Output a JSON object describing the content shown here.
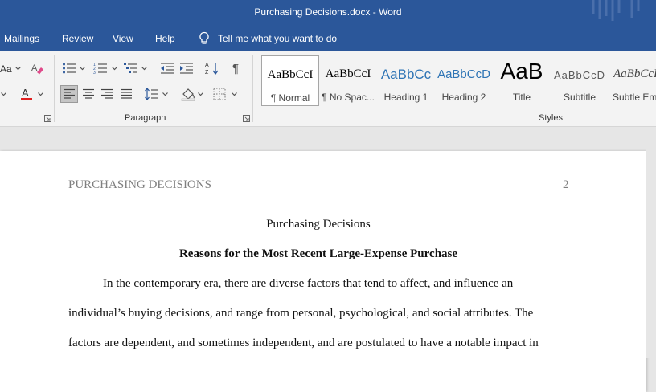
{
  "window": {
    "title": "Purchasing Decisions.docx  -  Word"
  },
  "menu": {
    "tabs": [
      "Mailings",
      "Review",
      "View",
      "Help"
    ],
    "tell_me": "Tell me what you want to do"
  },
  "ribbon": {
    "font_size_partial": "Aa",
    "paragraph_label": "Paragraph",
    "styles_label": "Styles",
    "styles": [
      {
        "sample": "AaBbCcI",
        "name": "¶ Normal"
      },
      {
        "sample": "AaBbCcI",
        "name": "¶ No Spac..."
      },
      {
        "sample": "AaBbCc",
        "name": "Heading 1"
      },
      {
        "sample": "AaBbCcD",
        "name": "Heading 2"
      },
      {
        "sample": "AaB",
        "name": "Title"
      },
      {
        "sample": "AaBbCcD",
        "name": "Subtitle"
      },
      {
        "sample": "AaBbCcD",
        "name": "Subtle Em..."
      }
    ]
  },
  "colors": {
    "brand": "#2b579a",
    "font_color": "#e02020",
    "heading_blue": "#2e74b5"
  },
  "document": {
    "running_head": "PURCHASING DECISIONS",
    "page_number": "2",
    "title": "Purchasing Decisions",
    "heading": "Reasons for the Most Recent Large-Expense Purchase",
    "lines": [
      "In the contemporary era, there are diverse factors that tend to affect, and influence an",
      "individual’s buying decisions, and range from personal, psychological, and social attributes. The",
      "factors are dependent, and sometimes independent, and are postulated to have a notable impact in"
    ]
  }
}
